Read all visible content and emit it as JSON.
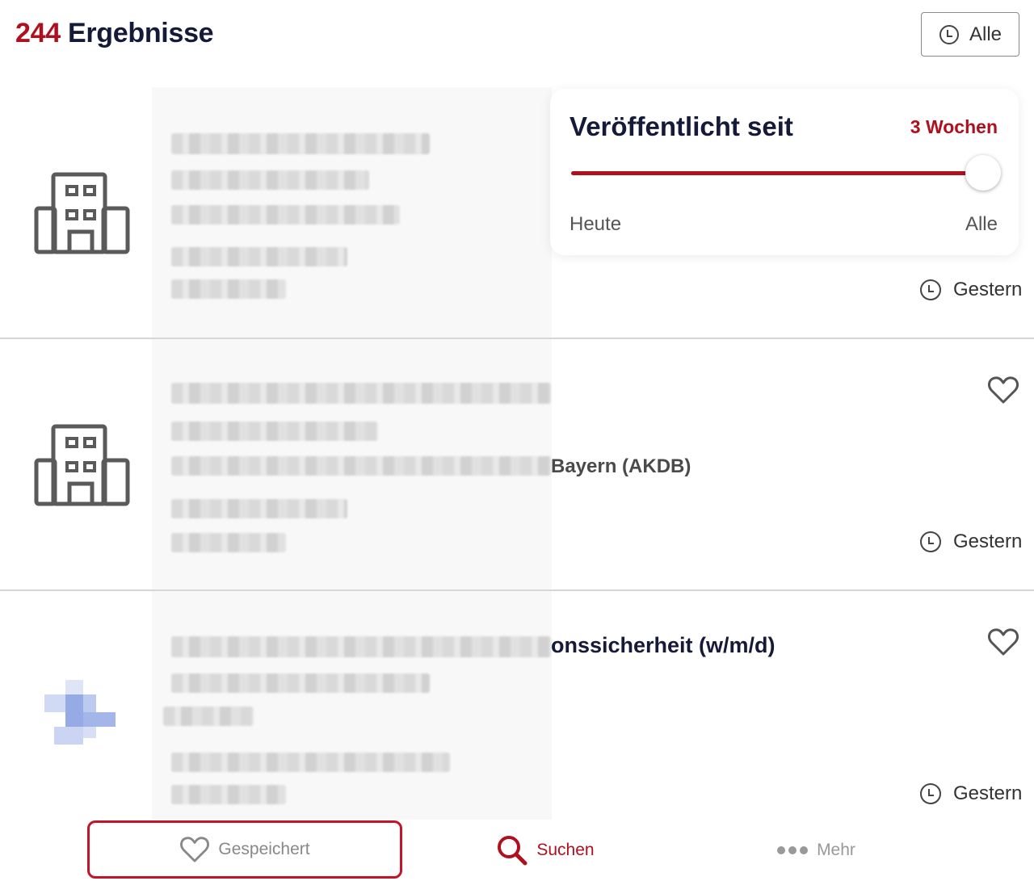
{
  "header": {
    "result_count": "244",
    "result_label": "Ergebnisse",
    "filter_button_label": "Alle"
  },
  "popup": {
    "title": "Veröffentlicht seit",
    "value": "3 Wochen",
    "slider_min": "Heute",
    "slider_max": "Alle",
    "slider_fraction": 1.0
  },
  "results": [
    {
      "visible_title_fragment": "",
      "visible_org_fragment": "",
      "date": "Gestern"
    },
    {
      "visible_title_fragment": "",
      "visible_org_fragment": "Bayern (AKDB)",
      "date": "Gestern"
    },
    {
      "visible_title_fragment": "onssicherheit (w/m/d)",
      "visible_org_fragment": "",
      "date": "Gestern"
    }
  ],
  "tabbar": {
    "saved_label": "Gespeichert",
    "search_label": "Suchen",
    "more_label": "Mehr"
  },
  "colors": {
    "accent": "#b0101e",
    "text_dark": "#141a38",
    "highlight_border": "#c4142a"
  },
  "icons": [
    "clock-icon",
    "building-icon",
    "heart-icon",
    "search-icon",
    "more-dots-icon"
  ]
}
